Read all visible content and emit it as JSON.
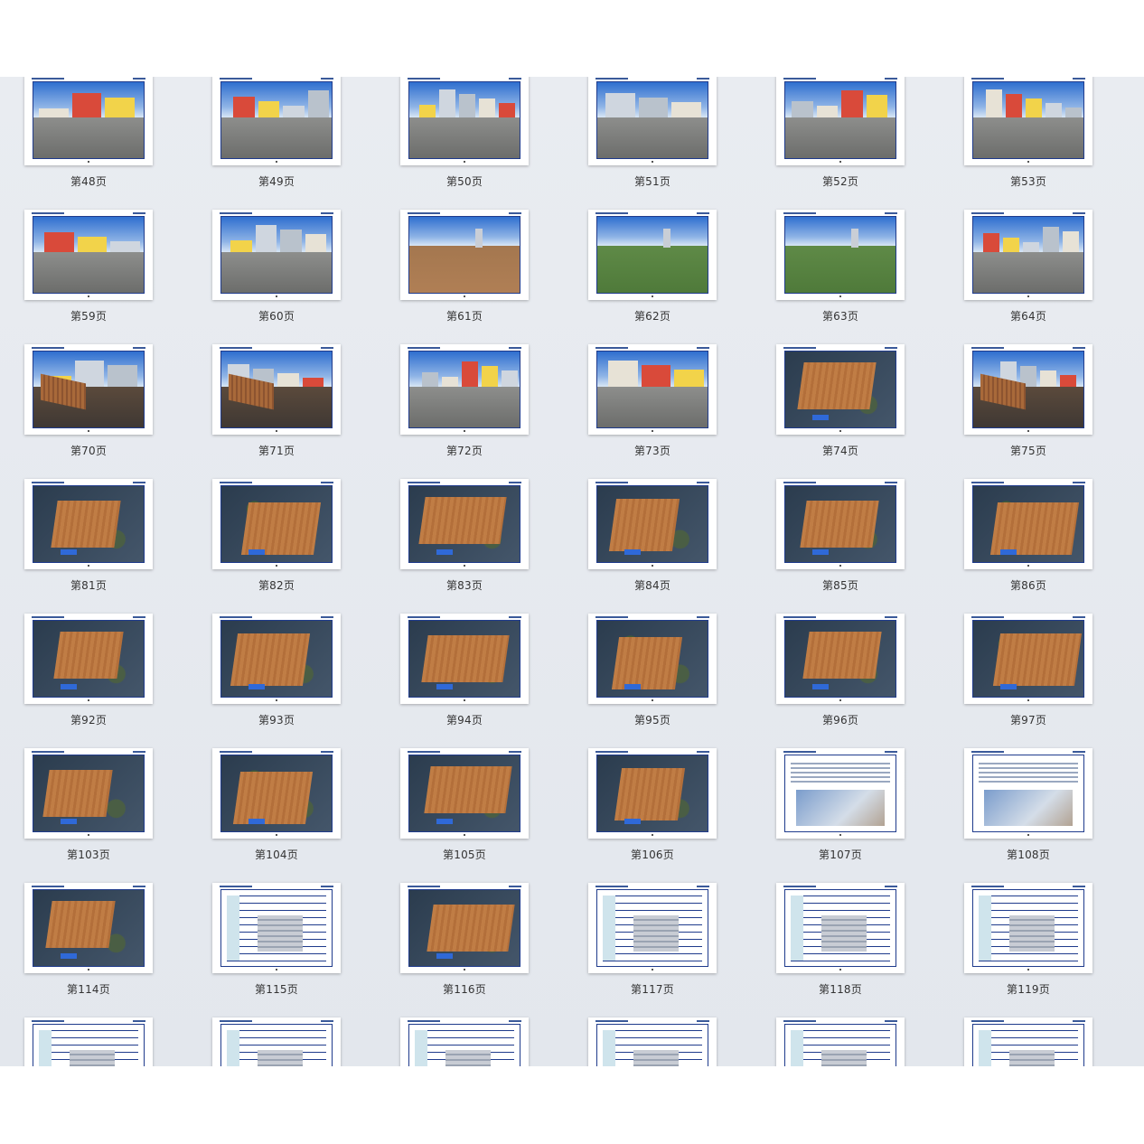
{
  "pages": [
    {
      "label": "第48页",
      "kind": "street"
    },
    {
      "label": "第49页",
      "kind": "street"
    },
    {
      "label": "第50页",
      "kind": "street"
    },
    {
      "label": "第51页",
      "kind": "street"
    },
    {
      "label": "第52页",
      "kind": "street"
    },
    {
      "label": "第53页",
      "kind": "street"
    },
    {
      "label": "第59页",
      "kind": "street"
    },
    {
      "label": "第60页",
      "kind": "street"
    },
    {
      "label": "第61页",
      "kind": "dirt"
    },
    {
      "label": "第62页",
      "kind": "grass"
    },
    {
      "label": "第63页",
      "kind": "grass"
    },
    {
      "label": "第64页",
      "kind": "street"
    },
    {
      "label": "第70页",
      "kind": "pit"
    },
    {
      "label": "第71页",
      "kind": "pit"
    },
    {
      "label": "第72页",
      "kind": "street"
    },
    {
      "label": "第73页",
      "kind": "street"
    },
    {
      "label": "第74页",
      "kind": "aerial"
    },
    {
      "label": "第75页",
      "kind": "pit"
    },
    {
      "label": "第81页",
      "kind": "aerial"
    },
    {
      "label": "第82页",
      "kind": "aerial"
    },
    {
      "label": "第83页",
      "kind": "aerial"
    },
    {
      "label": "第84页",
      "kind": "aerial"
    },
    {
      "label": "第85页",
      "kind": "aerial"
    },
    {
      "label": "第86页",
      "kind": "aerial"
    },
    {
      "label": "第92页",
      "kind": "aerial"
    },
    {
      "label": "第93页",
      "kind": "aerial"
    },
    {
      "label": "第94页",
      "kind": "aerial"
    },
    {
      "label": "第95页",
      "kind": "aerial"
    },
    {
      "label": "第96页",
      "kind": "aerial"
    },
    {
      "label": "第97页",
      "kind": "aerial"
    },
    {
      "label": "第103页",
      "kind": "aerial"
    },
    {
      "label": "第104页",
      "kind": "aerial"
    },
    {
      "label": "第105页",
      "kind": "aerial"
    },
    {
      "label": "第106页",
      "kind": "aerial"
    },
    {
      "label": "第107页",
      "kind": "doc"
    },
    {
      "label": "第108页",
      "kind": "doc"
    },
    {
      "label": "第114页",
      "kind": "aerial"
    },
    {
      "label": "第115页",
      "kind": "table"
    },
    {
      "label": "第116页",
      "kind": "aerial"
    },
    {
      "label": "第117页",
      "kind": "table"
    },
    {
      "label": "第118页",
      "kind": "table"
    },
    {
      "label": "第119页",
      "kind": "table"
    },
    {
      "label": "",
      "kind": "table"
    },
    {
      "label": "",
      "kind": "table"
    },
    {
      "label": "",
      "kind": "table"
    },
    {
      "label": "",
      "kind": "table"
    },
    {
      "label": "",
      "kind": "table"
    },
    {
      "label": "",
      "kind": "table"
    }
  ],
  "colors": {
    "frame": "#1f3b8c",
    "background": "#e6e9ee",
    "header_rule": "#3b5a9a"
  }
}
